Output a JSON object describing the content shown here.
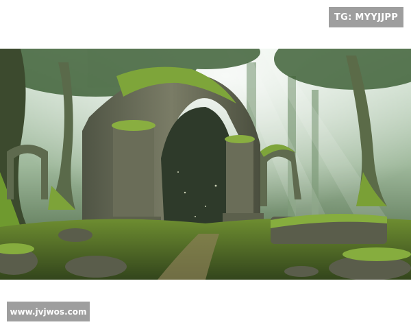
{
  "watermarks": {
    "top_right": "TG: MYYJJPP",
    "bottom_left": "www.jvjwos.com"
  },
  "image": {
    "description_name": "forest-ruins-scene",
    "colors": {
      "sky_haze": "#cfe3d4",
      "deep_forest": "#2f4632",
      "moss": "#7fa23a",
      "stone": "#6b6e5a",
      "ground": "#5f7a2c"
    }
  }
}
